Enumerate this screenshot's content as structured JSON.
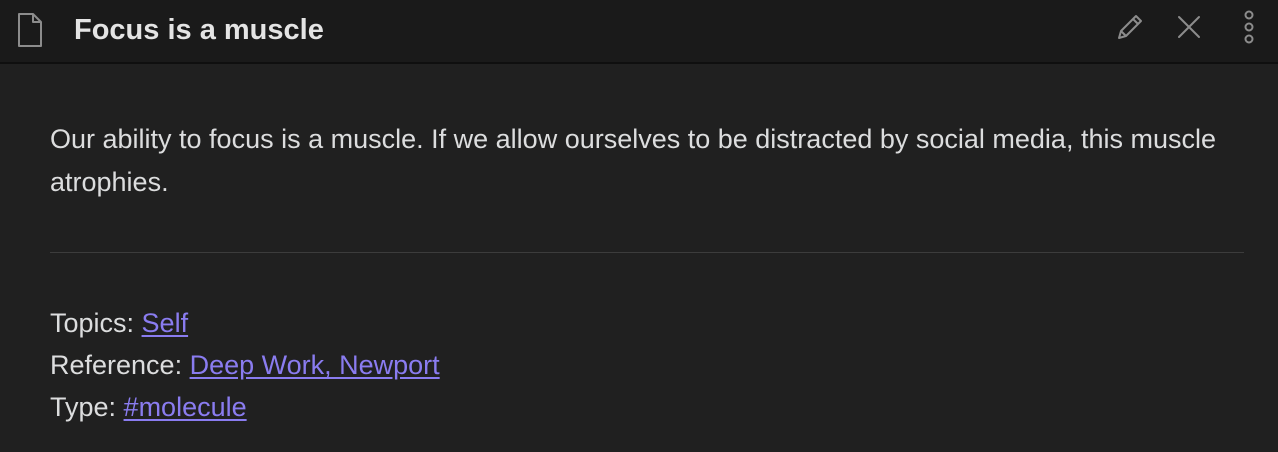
{
  "header": {
    "file_icon": "file-document-icon",
    "title": "Focus is a muscle",
    "actions": [
      {
        "icon": "pencil-icon",
        "role": "edit"
      },
      {
        "icon": "close-icon",
        "role": "close"
      },
      {
        "icon": "more-vertical-icon",
        "role": "more options"
      }
    ]
  },
  "note": {
    "body": "Our ability to focus is a muscle. If we allow ourselves to be distracted by social media, this muscle atrophies.",
    "metadata": {
      "topics_label": "Topics: ",
      "topics_link": "Self",
      "reference_label": "Reference: ",
      "reference_link": "Deep Work, Newport",
      "type_label": "Type: ",
      "type_link": "#molecule"
    }
  },
  "colors": {
    "background": "#202020",
    "titlebar": "#1a1a1a",
    "text": "#dcddde",
    "link": "#8a7cf0",
    "icon": "#8c8c8c"
  }
}
